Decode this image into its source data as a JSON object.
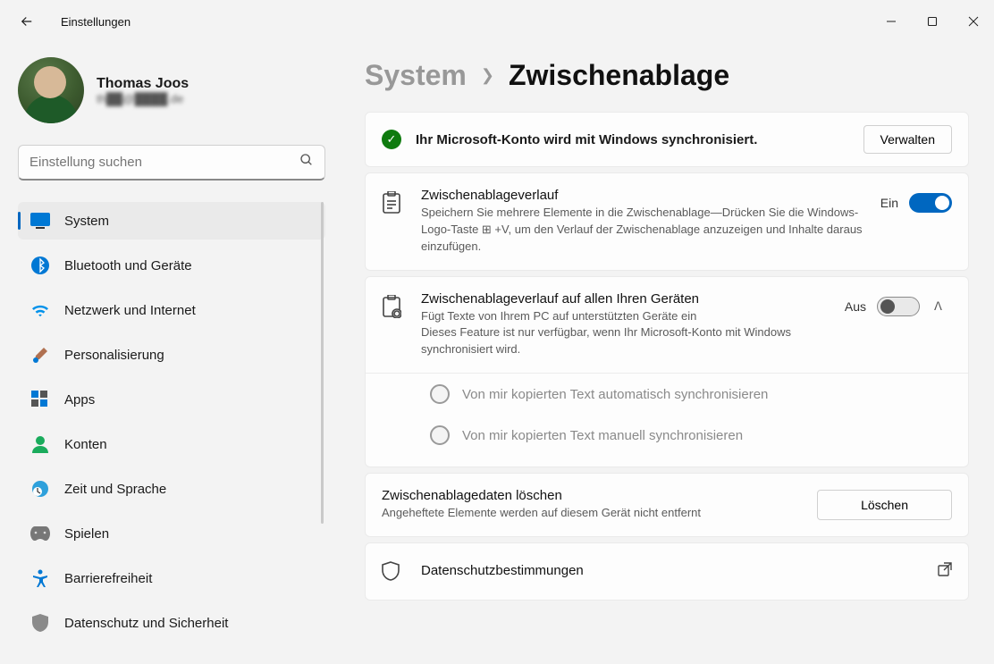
{
  "titlebar": {
    "app": "Einstellungen"
  },
  "profile": {
    "name": "Thomas Joos",
    "email": "th██@████.de"
  },
  "search": {
    "placeholder": "Einstellung suchen"
  },
  "nav": {
    "items": [
      {
        "label": "System"
      },
      {
        "label": "Bluetooth und Geräte"
      },
      {
        "label": "Netzwerk und Internet"
      },
      {
        "label": "Personalisierung"
      },
      {
        "label": "Apps"
      },
      {
        "label": "Konten"
      },
      {
        "label": "Zeit und Sprache"
      },
      {
        "label": "Spielen"
      },
      {
        "label": "Barrierefreiheit"
      },
      {
        "label": "Datenschutz und Sicherheit"
      }
    ]
  },
  "breadcrumb": {
    "parent": "System",
    "current": "Zwischenablage"
  },
  "sync_banner": {
    "text": "Ihr Microsoft-Konto wird mit Windows synchronisiert.",
    "button": "Verwalten"
  },
  "history": {
    "title": "Zwischenablageverlauf",
    "desc": "Speichern Sie mehrere Elemente in die Zwischenablage—Drücken Sie die Windows-Logo-Taste ⊞ +V, um den Verlauf der Zwischenablage anzuzeigen und Inhalte daraus einzufügen.",
    "state": "Ein"
  },
  "sync": {
    "title": "Zwischenablageverlauf auf allen Ihren Geräten",
    "desc1": "Fügt Texte von Ihrem PC auf unterstützten Geräte ein",
    "desc2": "Dieses Feature ist nur verfügbar, wenn Ihr Microsoft-Konto mit Windows synchronisiert wird.",
    "state": "Aus",
    "radio1": "Von mir kopierten Text automatisch synchronisieren",
    "radio2": "Von mir kopierten Text manuell synchronisieren"
  },
  "clear": {
    "title": "Zwischenablagedaten löschen",
    "desc": "Angeheftete Elemente werden auf diesem Gerät nicht entfernt",
    "button": "Löschen"
  },
  "privacy": {
    "title": "Datenschutzbestimmungen"
  }
}
